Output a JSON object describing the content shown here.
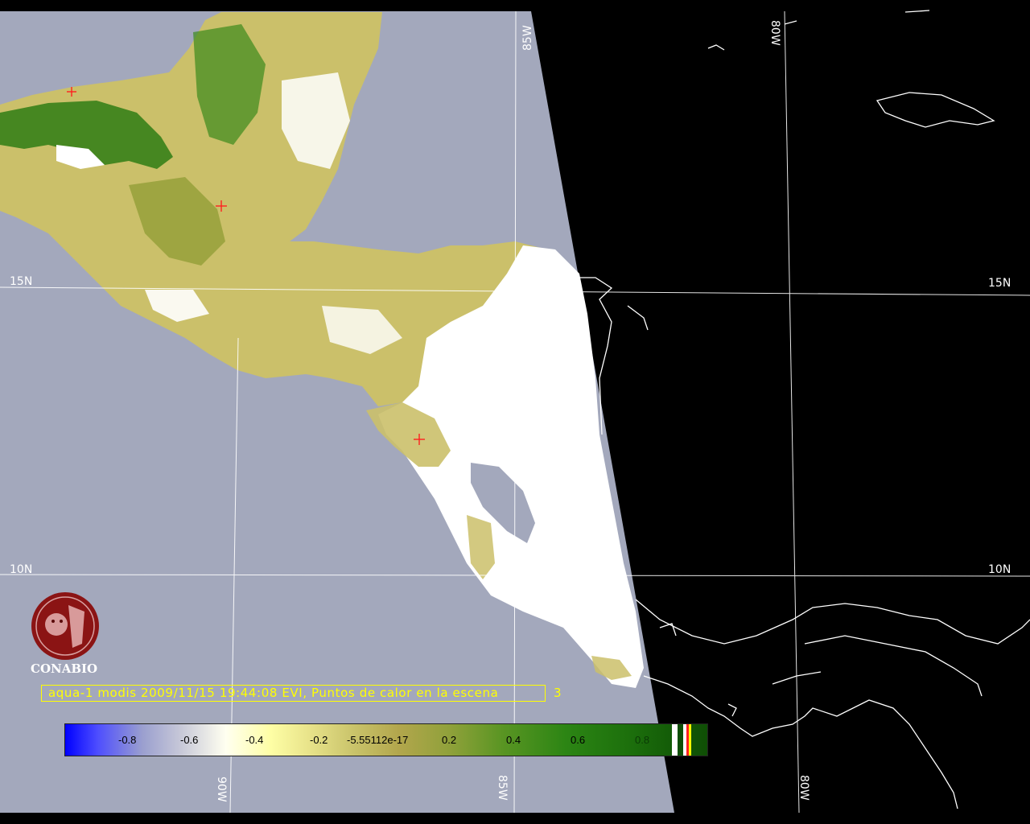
{
  "map": {
    "lat_labels": [
      "15N",
      "15N",
      "10N",
      "10N"
    ],
    "lon_labels_top": [
      "85W",
      "80W"
    ],
    "lon_labels_bottom": [
      "90W",
      "85W",
      "80W"
    ]
  },
  "logo": {
    "text": "CONABIO"
  },
  "caption": {
    "text": "aqua-1 modis 2009/11/15 19:44:08 EVI, Puntos de calor en la escena",
    "count": "3"
  },
  "colorbar": {
    "ticks": [
      "-0.8",
      "-0.6",
      "-0.4",
      "-0.2",
      "-5.55112e-17",
      "0.2",
      "0.4",
      "0.6",
      "0.8"
    ]
  },
  "colors": {
    "ocean_day": "#a3a8bc",
    "night": "#000000",
    "cloud": "#ffffff",
    "veg_low": "#d2c870",
    "veg_high": "#2e7d14",
    "caption": "#ffff00",
    "hotspot": "#ff2020"
  }
}
